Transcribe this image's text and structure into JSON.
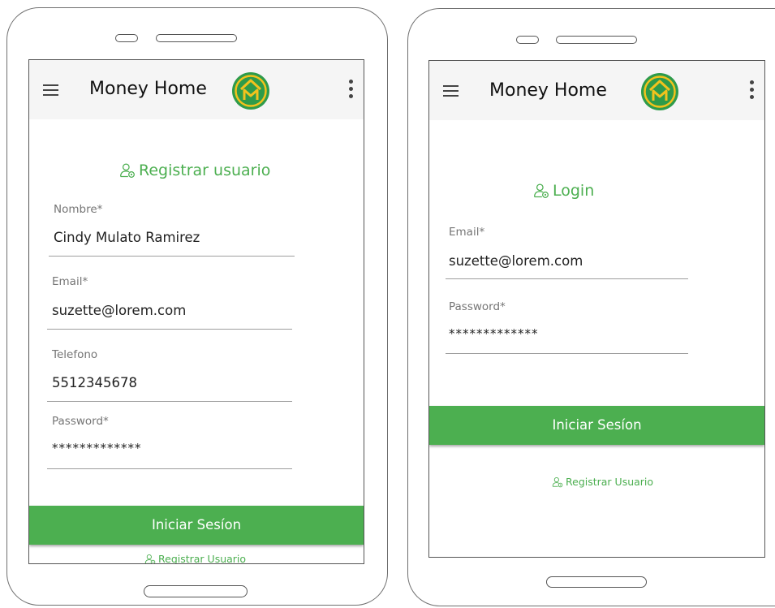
{
  "colors": {
    "accent": "#4caf50",
    "appbar_bg": "#f5f5f5",
    "logo_outer": "#2e9b4a",
    "logo_inner": "#f2c21d"
  },
  "app": {
    "title": "Money Home",
    "logo_icon": "money-home-logo-icon",
    "menu_icon": "hamburger-menu-icon",
    "overflow_icon": "kebab-menu-icon"
  },
  "register_screen": {
    "heading": "Registrar usuario",
    "heading_icon": "user-add-icon",
    "fields": {
      "nombre": {
        "label": "Nombre*",
        "value": "Cindy Mulato Ramirez"
      },
      "email": {
        "label": "Email*",
        "value": "suzette@lorem.com"
      },
      "telefono": {
        "label": "Telefono",
        "value": "5512345678"
      },
      "password": {
        "label": "Password*",
        "value": "*************"
      }
    },
    "submit_label": "Iniciar Sesíon",
    "link_label": "Registrar Usuario"
  },
  "login_screen": {
    "heading": "Login",
    "heading_icon": "user-add-icon",
    "fields": {
      "email": {
        "label": "Email*",
        "value": "suzette@lorem.com"
      },
      "password": {
        "label": "Password*",
        "value": "*************"
      }
    },
    "submit_label": "Iniciar Sesíon",
    "link_label": "Registrar Usuario"
  }
}
